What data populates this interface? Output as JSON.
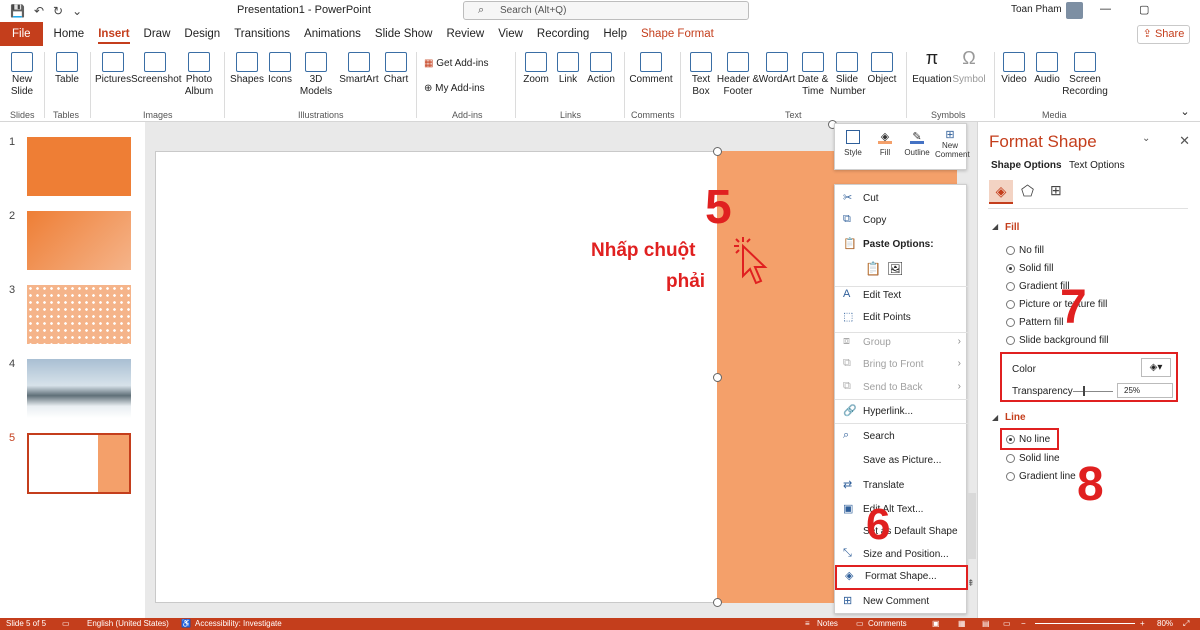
{
  "title_bar": {
    "document_title": "Presentation1 - PowerPoint",
    "search_placeholder": "Search (Alt+Q)",
    "user_name": "Toan Pham"
  },
  "tabs": [
    "File",
    "Home",
    "Insert",
    "Draw",
    "Design",
    "Transitions",
    "Animations",
    "Slide Show",
    "Review",
    "View",
    "Recording",
    "Help",
    "Shape Format"
  ],
  "share_label": "Share",
  "ribbon": {
    "buttons": [
      "New Slide",
      "Table",
      "Pictures",
      "Screenshot",
      "Photo Album",
      "Shapes",
      "Icons",
      "3D Models",
      "SmartArt",
      "Chart",
      "Get Add-ins",
      "My Add-ins",
      "Zoom",
      "Link",
      "Action",
      "Comment",
      "Text Box",
      "Header & Footer",
      "WordArt",
      "Date & Time",
      "Slide Number",
      "Object",
      "Equation",
      "Symbol",
      "Video",
      "Audio",
      "Screen Recording"
    ],
    "groups": [
      "Slides",
      "Tables",
      "Images",
      "Illustrations",
      "Add-ins",
      "Links",
      "Comments",
      "Text",
      "Symbols",
      "Media"
    ]
  },
  "slides": {
    "numbers": [
      "1",
      "2",
      "3",
      "4",
      "5"
    ],
    "active": 5
  },
  "annotations": {
    "step5": "5",
    "right_click_line1": "Nhấp chuột",
    "right_click_line2": "phải",
    "step6": "6",
    "step7": "7",
    "step8": "8"
  },
  "mini_toolbar": {
    "style": "Style",
    "fill": "Fill",
    "outline": "Outline",
    "new_comment": "New Comment"
  },
  "context_menu": {
    "cut": "Cut",
    "copy": "Copy",
    "paste_options": "Paste Options:",
    "edit_text": "Edit Text",
    "edit_points": "Edit Points",
    "group": "Group",
    "bring_to_front": "Bring to Front",
    "send_to_back": "Send to Back",
    "hyperlink": "Hyperlink...",
    "search": "Search",
    "save_as_picture": "Save as Picture...",
    "translate": "Translate",
    "edit_alt_text": "Edit Alt Text...",
    "set_default_shape": "Set as Default Shape",
    "size_position": "Size and Position...",
    "format_shape": "Format Shape...",
    "new_comment": "New Comment"
  },
  "format_pane": {
    "title": "Format Shape",
    "tab_shape": "Shape Options",
    "tab_text": "Text Options",
    "fill_section": "Fill",
    "fill_options": [
      "No fill",
      "Solid fill",
      "Gradient fill",
      "Picture or texture fill",
      "Pattern fill",
      "Slide background fill"
    ],
    "fill_selected": 1,
    "color_label": "Color",
    "transparency_label": "Transparency",
    "transparency_value": "25%",
    "transparency_fraction": 0.25,
    "line_section": "Line",
    "line_options": [
      "No line",
      "Solid line",
      "Gradient line"
    ],
    "line_selected": 0
  },
  "status_bar": {
    "slide_info": "Slide 5 of 5",
    "language": "English (United States)",
    "accessibility": "Accessibility: Investigate",
    "notes": "Notes",
    "comments": "Comments",
    "zoom": "80%"
  },
  "colors": {
    "accent": "#c43e1c",
    "shape_fill": "#f4a06a",
    "highlight": "#e02020"
  }
}
